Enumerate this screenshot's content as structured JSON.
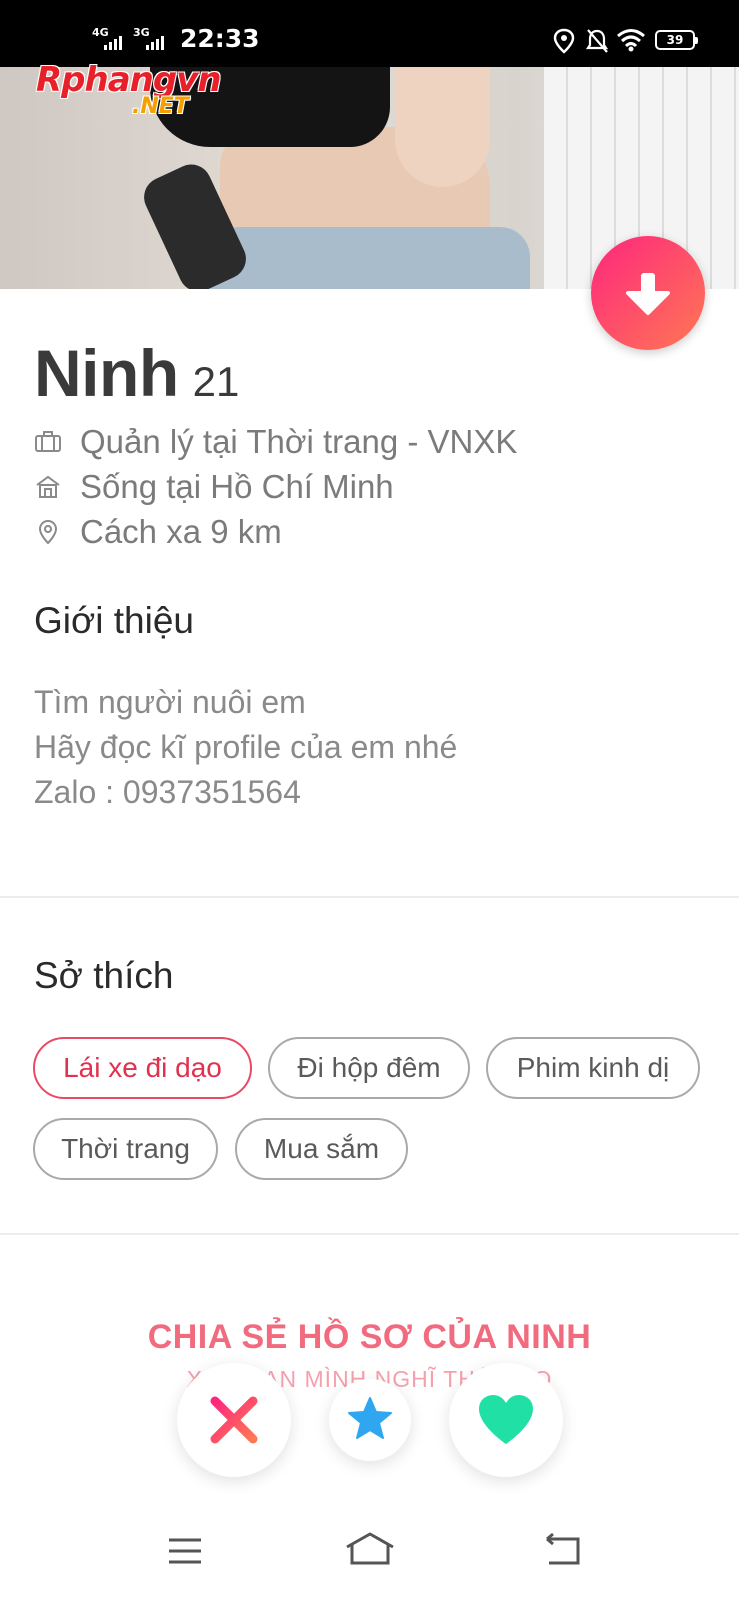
{
  "status_bar": {
    "net1": "4G",
    "net2": "3G",
    "time": "22:33",
    "battery": "39"
  },
  "watermark": {
    "main": "Rphangvn",
    "suffix": ".NET"
  },
  "profile": {
    "name": "Ninh",
    "age": "21",
    "job": "Quản lý tại Thời trang - VNXK",
    "lives": "Sống tại Hồ Chí Minh",
    "distance": "Cách xa 9 km"
  },
  "about": {
    "heading": "Giới thiệu",
    "lines": [
      "Tìm người nuôi em",
      "Hãy đọc kĩ profile của em nhé",
      "Zalo : 0937351564"
    ]
  },
  "interests": {
    "heading": "Sở thích",
    "chips": [
      "Lái xe đi dạo",
      "Đi hộp đêm",
      "Phim kinh dị",
      "Thời trang",
      "Mua sắm"
    ]
  },
  "share": {
    "title": "CHIA SẺ HỒ SƠ CỦA NINH",
    "subtitle": "XEM BẠN MÌNH NGHĨ THẾ NÀO"
  },
  "icons": {
    "nope": "close-icon",
    "superlike": "star-icon",
    "like": "heart-icon"
  },
  "colors": {
    "brand_gradient_start": "#fd267d",
    "brand_gradient_end": "#ff7854",
    "like": "#21e0a6",
    "superlike": "#2fa6f0"
  }
}
